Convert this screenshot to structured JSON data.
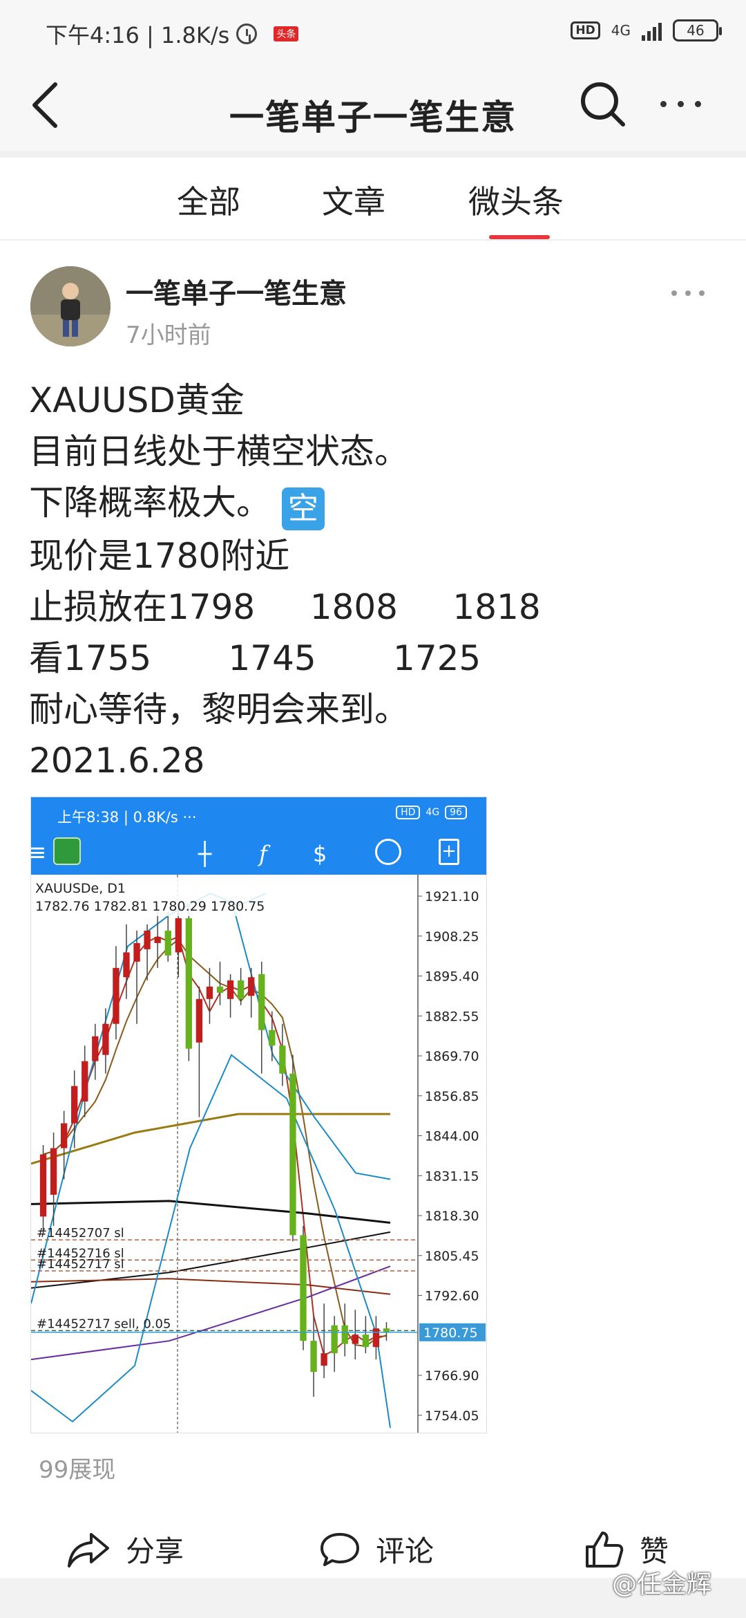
{
  "status_bar": {
    "time_speed": "下午4:16 | 1.8K/s",
    "badge": "头条",
    "hd": "HD",
    "network": "4G",
    "battery": "46"
  },
  "app_bar": {
    "title": "一笔单子一笔生意"
  },
  "tabs": [
    {
      "label": "全部"
    },
    {
      "label": "文章"
    },
    {
      "label": "微头条"
    }
  ],
  "post": {
    "author": "一笔单子一笔生意",
    "time": "7小时前",
    "lines": [
      "XAUUSD黄金",
      "目前日线处于横空状态。",
      "下降概率极大。",
      "现价是1780附近",
      "止损放在1798     1808     1818",
      "看1755       1745       1725",
      "耐心等待，黎明会来到。",
      "2021.6.28"
    ],
    "emoji_label": "空",
    "views": "99展现"
  },
  "embedded_screenshot": {
    "status": "上午8:38 | 0.8K/s",
    "status_dots": "···",
    "hd": "HD",
    "network": "4G",
    "battery": "96",
    "toolbar_icons": [
      "menu-icon",
      "metatrader-logo-icon",
      "crosshair-icon",
      "function-icon",
      "trade-icon",
      "clock-icon",
      "new-order-icon"
    ],
    "chart_data": {
      "type": "candlestick",
      "symbol_label": "XAUUSDe, D1",
      "ohlc_label": "1782.76 1782.81 1780.29 1780.75",
      "y_ticks": [
        "1921.10",
        "1908.25",
        "1895.40",
        "1882.55",
        "1869.70",
        "1856.85",
        "1844.00",
        "1831.15",
        "1818.30",
        "1805.45",
        "1792.60",
        "1780.75",
        "1766.90",
        "1754.05"
      ],
      "ylim": [
        1748,
        1928
      ],
      "current_price": "1780.75",
      "order_labels": [
        "#14452707 sl",
        "#14452716 sl",
        "#14452717 sl",
        "#14452717 sell, 0.05"
      ],
      "order_levels": [
        1810.5,
        1804,
        1800.5,
        1781.3
      ],
      "candles": [
        {
          "o": 1818,
          "h": 1841,
          "l": 1812,
          "c": 1838,
          "bull": false
        },
        {
          "o": 1825,
          "h": 1845,
          "l": 1815,
          "c": 1840,
          "bull": false
        },
        {
          "o": 1840,
          "h": 1852,
          "l": 1830,
          "c": 1848,
          "bull": false
        },
        {
          "o": 1848,
          "h": 1865,
          "l": 1840,
          "c": 1860,
          "bull": false
        },
        {
          "o": 1855,
          "h": 1873,
          "l": 1850,
          "c": 1868,
          "bull": false
        },
        {
          "o": 1868,
          "h": 1880,
          "l": 1862,
          "c": 1876,
          "bull": false
        },
        {
          "o": 1870,
          "h": 1885,
          "l": 1864,
          "c": 1880,
          "bull": false
        },
        {
          "o": 1880,
          "h": 1905,
          "l": 1875,
          "c": 1898,
          "bull": false
        },
        {
          "o": 1895,
          "h": 1912,
          "l": 1888,
          "c": 1903,
          "bull": false
        },
        {
          "o": 1900,
          "h": 1910,
          "l": 1880,
          "c": 1906,
          "bull": false
        },
        {
          "o": 1904,
          "h": 1912,
          "l": 1894,
          "c": 1910,
          "bull": false
        },
        {
          "o": 1906,
          "h": 1916,
          "l": 1898,
          "c": 1908,
          "bull": false
        },
        {
          "o": 1910,
          "h": 1916,
          "l": 1900,
          "c": 1902,
          "bull": true
        },
        {
          "o": 1903,
          "h": 1918,
          "l": 1895,
          "c": 1914,
          "bull": false
        },
        {
          "o": 1914,
          "h": 1918,
          "l": 1868,
          "c": 1872,
          "bull": true
        },
        {
          "o": 1874,
          "h": 1892,
          "l": 1850,
          "c": 1888,
          "bull": false
        },
        {
          "o": 1888,
          "h": 1898,
          "l": 1880,
          "c": 1892,
          "bull": false
        },
        {
          "o": 1892,
          "h": 1900,
          "l": 1886,
          "c": 1890,
          "bull": true
        },
        {
          "o": 1888,
          "h": 1896,
          "l": 1882,
          "c": 1894,
          "bull": false
        },
        {
          "o": 1894,
          "h": 1898,
          "l": 1886,
          "c": 1888,
          "bull": true
        },
        {
          "o": 1889,
          "h": 1898,
          "l": 1882,
          "c": 1895,
          "bull": false
        },
        {
          "o": 1896,
          "h": 1900,
          "l": 1864,
          "c": 1878,
          "bull": true
        },
        {
          "o": 1878,
          "h": 1884,
          "l": 1868,
          "c": 1873,
          "bull": true
        },
        {
          "o": 1873,
          "h": 1880,
          "l": 1860,
          "c": 1864,
          "bull": true
        },
        {
          "o": 1864,
          "h": 1870,
          "l": 1810,
          "c": 1812,
          "bull": true
        },
        {
          "o": 1812,
          "h": 1815,
          "l": 1775,
          "c": 1778,
          "bull": true
        },
        {
          "o": 1778,
          "h": 1786,
          "l": 1760,
          "c": 1768,
          "bull": true
        },
        {
          "o": 1770,
          "h": 1790,
          "l": 1766,
          "c": 1774,
          "bull": false
        },
        {
          "o": 1774,
          "h": 1786,
          "l": 1768,
          "c": 1783,
          "bull": true
        },
        {
          "o": 1783,
          "h": 1790,
          "l": 1773,
          "c": 1777,
          "bull": true
        },
        {
          "o": 1777,
          "h": 1788,
          "l": 1772,
          "c": 1780,
          "bull": false
        },
        {
          "o": 1780,
          "h": 1786,
          "l": 1774,
          "c": 1776,
          "bull": true
        },
        {
          "o": 1776,
          "h": 1786,
          "l": 1772,
          "c": 1782,
          "bull": false
        },
        {
          "o": 1782,
          "h": 1784,
          "l": 1778,
          "c": 1780.75,
          "bull": true
        }
      ]
    }
  },
  "actions": [
    {
      "label": "分享",
      "icon": "share-icon"
    },
    {
      "label": "评论",
      "icon": "comment-icon"
    },
    {
      "label": "赞",
      "icon": "like-icon"
    }
  ],
  "watermark": "@任金辉",
  "colors": {
    "accent": "#e8373e",
    "mt_blue": "#1e88f0",
    "bull_candle": "#66b21c",
    "bear_candle": "#c21e1e"
  }
}
